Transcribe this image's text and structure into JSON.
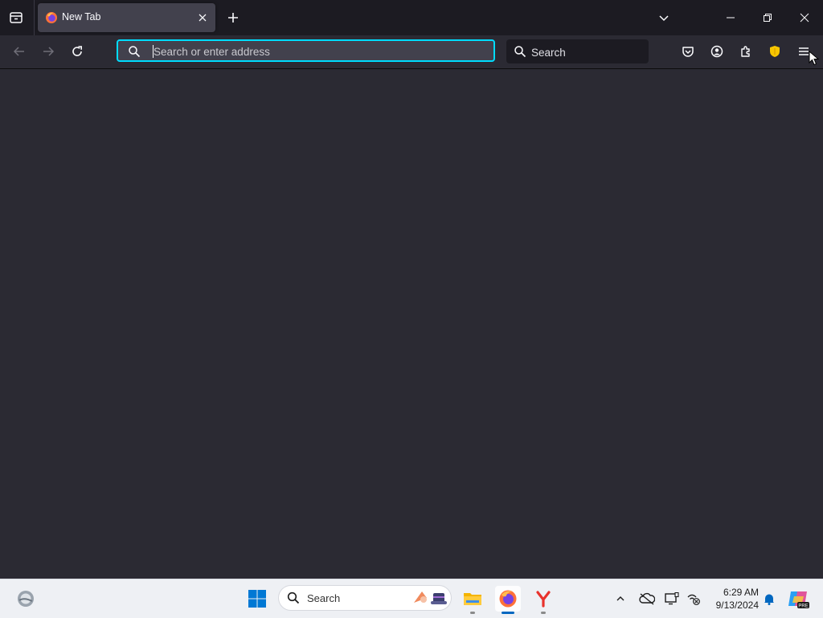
{
  "window": {
    "title": "New Tab"
  },
  "tabs": [
    {
      "label": "New Tab",
      "active": true
    }
  ],
  "navbar": {
    "address_placeholder": "Search or enter address",
    "address_value": "",
    "search_placeholder": "Search"
  },
  "taskbar": {
    "search_label": "Search",
    "clock": {
      "time": "6:29 AM",
      "date": "9/13/2024"
    },
    "apps": [
      "widgets-icon",
      "start-icon",
      "file-explorer-icon",
      "firefox-icon",
      "yandex-browser-icon"
    ]
  },
  "colors": {
    "tabstrip_bg": "#1c1b22",
    "toolbar_bg": "#2b2a33",
    "focus_ring": "#00ddff",
    "taskbar_bg": "#eef0f4",
    "accent_blue": "#0067c0"
  }
}
